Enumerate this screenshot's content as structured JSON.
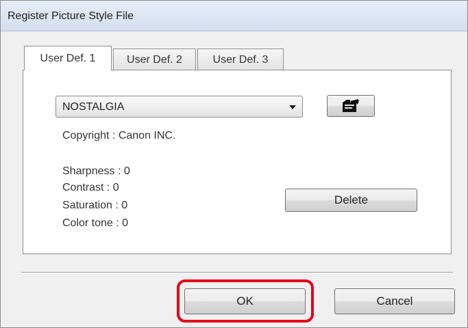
{
  "dialog": {
    "title": "Register Picture Style File"
  },
  "tabs": [
    {
      "label": "User Def. 1",
      "active": true
    },
    {
      "label": "User Def. 2",
      "active": false
    },
    {
      "label": "User Def. 3",
      "active": false
    }
  ],
  "style_select": {
    "selected_value": "NOSTALGIA"
  },
  "load_button": {
    "icon": "open-folder-icon"
  },
  "copyright_text": "Copyright : Canon INC.",
  "parameters": {
    "sharpness": "Sharpness : 0",
    "contrast": "Contrast : 0",
    "saturation": "Saturation : 0",
    "color_tone": "Color tone : 0"
  },
  "buttons": {
    "delete": "Delete",
    "ok": "OK",
    "cancel": "Cancel"
  },
  "colors": {
    "highlight": "#e2001a"
  }
}
